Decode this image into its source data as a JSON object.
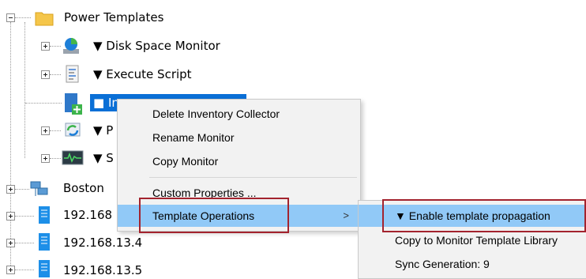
{
  "tree": {
    "root": {
      "label": "Power Templates"
    },
    "children": [
      {
        "label": "▼ Disk Space Monitor"
      },
      {
        "label": "▼ Execute Script"
      },
      {
        "label": "■ In"
      },
      {
        "label": "▼ P"
      },
      {
        "label": "▼ S"
      }
    ],
    "siblings": [
      {
        "label": "Boston"
      },
      {
        "label": "192.168"
      },
      {
        "label": "192.168.13.4"
      },
      {
        "label": "192.168.13.5"
      }
    ]
  },
  "context_menu": {
    "items": [
      "Delete  Inventory Collector",
      "Rename Monitor",
      "Copy Monitor",
      "Custom Properties ...",
      "Template Operations"
    ],
    "submenu_arrow": ">"
  },
  "submenu": {
    "items": [
      "▼ Enable template propagation",
      "Copy to Monitor Template Library",
      "Sync Generation: 9"
    ]
  },
  "colors": {
    "selection": "#0a6fd6",
    "menu_highlight": "#91c9f7",
    "annotation_box": "#a3232e",
    "folder": "#f5c64a"
  }
}
